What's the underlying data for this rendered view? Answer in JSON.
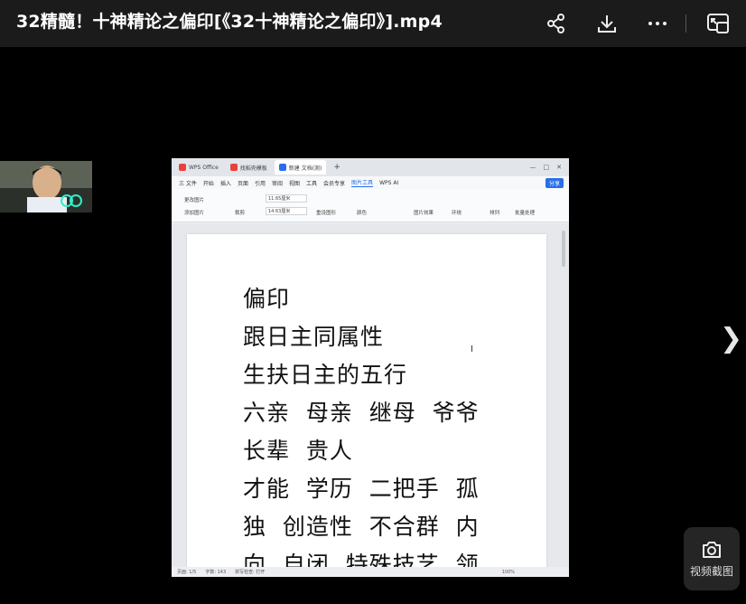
{
  "player": {
    "title": "32精髓！十神精论之偏印[《32十神精论之偏印》].mp4",
    "icons": [
      "share-icon",
      "download-icon",
      "more-icon",
      "pip-icon"
    ],
    "screenshot_label": "视频截图"
  },
  "wps": {
    "tabs": [
      "WPS Office",
      "找稻壳模板",
      "新建 文档(测)"
    ],
    "ribbon_tabs": [
      "三 文件",
      "开始",
      "插入",
      "页面",
      "引用",
      "审阅",
      "视图",
      "工具",
      "会员专享",
      "图片工具",
      "WPS AI"
    ],
    "share_label": "分享",
    "toolbar": {
      "replace_image": "更改图片",
      "add_text": "添加图片",
      "crop": "裁剪",
      "width_value": "11.65厘米",
      "height_value": "14.63厘米",
      "reset": "重设图形",
      "color": "颜色",
      "effects": "图片效果",
      "wrap": "环绕",
      "arrange": "排列",
      "batch": "批量处理"
    },
    "doc_lines": [
      "偏印",
      "跟日主同属性",
      "生扶日主的五行",
      "六亲  母亲  继母  爷爷",
      "长辈  贵人",
      "才能  学历  二把手  孤",
      "独  创造性  不合群  内",
      "向  自闭  特殊技艺  领"
    ],
    "status": {
      "page": "页面: 1/5",
      "words": "字数: 143",
      "spell": "拼写检查: 打开",
      "zoom": "100%"
    }
  },
  "colors": {
    "accent": "#2a6ee8",
    "topbar": "#1b1b1b",
    "background": "#000000"
  }
}
